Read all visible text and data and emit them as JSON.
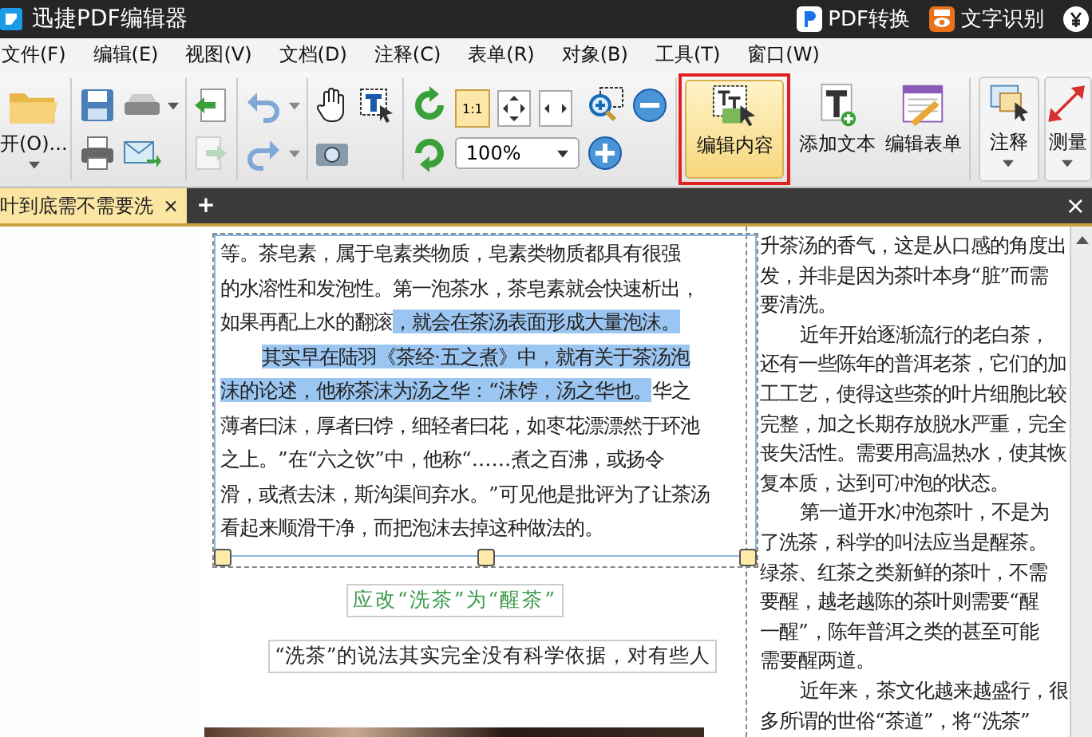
{
  "title_bar": {
    "title": "迅捷PDF编辑器",
    "actions": [
      {
        "kind": "pdf",
        "label": "PDF转换"
      },
      {
        "kind": "ocr",
        "label": "文字识别"
      }
    ]
  },
  "menu": [
    "文件(F)",
    "编辑(E)",
    "视图(V)",
    "文档(D)",
    "注释(C)",
    "表单(R)",
    "对象(B)",
    "工具(T)",
    "窗口(W)"
  ],
  "toolbar": {
    "open": {
      "label": "开(O)..."
    },
    "actual_size": {
      "label": "1:1",
      "selected": true
    },
    "zoom": {
      "value": "100%"
    },
    "edit_content": {
      "label": "编辑内容",
      "selected": true,
      "framed": true
    },
    "add_text": {
      "label": "添加文本"
    },
    "edit_form": {
      "label": "编辑表单"
    },
    "annotate": {
      "label": "注释"
    },
    "measure": {
      "label": "测量"
    }
  },
  "tabs": [
    {
      "label": "叶到底需不需要洗",
      "selected": true,
      "close": "×"
    }
  ],
  "tab_add": "+",
  "tab_bar_close": "×",
  "left_column": {
    "selected": true,
    "lines": [
      {
        "indent": false,
        "segments": [
          {
            "text": "等。茶皂素，属于皂素类物质，皂素类物质都具有很强",
            "selected": false
          }
        ]
      },
      {
        "indent": false,
        "segments": [
          {
            "text": "的水溶性和发泡性。第一泡茶水，茶皂素就会快速析出，",
            "selected": false
          }
        ]
      },
      {
        "indent": false,
        "segments": [
          {
            "text": "如果再配上水的翻滚",
            "selected": false
          },
          {
            "text": "，就会在茶汤表面形成大量泡沫。",
            "selected": true
          }
        ]
      },
      {
        "indent": true,
        "segments": [
          {
            "text": "其实早在陆羽《茶经·五之煮》中，就有关于茶汤泡",
            "selected": true
          }
        ]
      },
      {
        "indent": false,
        "segments": [
          {
            "text": "沫的论述，他称茶沫为汤之华：“沫饽，汤之华也。",
            "selected": true
          },
          {
            "text": "华之",
            "selected": false
          }
        ]
      },
      {
        "indent": false,
        "segments": [
          {
            "text": "薄者曰沫，厚者曰饽，细轻者曰花，如枣花漂漂然于环池",
            "selected": false
          }
        ]
      },
      {
        "indent": false,
        "segments": [
          {
            "text": "之上。”在“六之饮”中，他称“……煮之百沸，或扬令",
            "selected": false
          }
        ]
      },
      {
        "indent": false,
        "segments": [
          {
            "text": "滑，或煮去沫，斯沟渠间弃水。”可见他是批评为了让茶汤",
            "selected": false
          }
        ]
      },
      {
        "indent": false,
        "segments": [
          {
            "text": "看起来顺滑干净，而把泡沫去掉这种做法的。",
            "selected": false
          }
        ]
      }
    ]
  },
  "caption": "应改“洗茶”为“醒茶”",
  "boxed_line": "“洗茶”的说法其实完全没有科学依据，对有些人",
  "right_column": [
    {
      "indent": false,
      "text": "升茶汤的香气，这是从口感的角度出"
    },
    {
      "indent": false,
      "text": "发，并非是因为茶叶本身“脏”而需"
    },
    {
      "indent": false,
      "text": "要清洗。"
    },
    {
      "indent": true,
      "text": "近年开始逐渐流行的老白茶，"
    },
    {
      "indent": false,
      "text": "还有一些陈年的普洱老茶，它们的加"
    },
    {
      "indent": false,
      "text": "工工艺，使得这些茶的叶片细胞比较"
    },
    {
      "indent": false,
      "text": "完整，加之长期存放脱水严重，完全"
    },
    {
      "indent": false,
      "text": "丧失活性。需要用高温热水，使其恢"
    },
    {
      "indent": false,
      "text": "复本质，达到可冲泡的状态。"
    },
    {
      "indent": true,
      "text": "第一道开水冲泡茶叶，不是为"
    },
    {
      "indent": false,
      "text": "了洗茶，科学的叫法应当是醒茶。"
    },
    {
      "indent": false,
      "text": "绿茶、红茶之类新鲜的茶叶，不需"
    },
    {
      "indent": false,
      "text": "要醒，越老越陈的茶叶则需要“醒"
    },
    {
      "indent": false,
      "text": "一醒”，陈年普洱之类的甚至可能"
    },
    {
      "indent": false,
      "text": "需要醒两道。"
    },
    {
      "indent": true,
      "text": "近年来，茶文化越来越盛行，很"
    },
    {
      "indent": false,
      "text": "多所谓的世俗“茶道”，将“洗茶”"
    }
  ]
}
